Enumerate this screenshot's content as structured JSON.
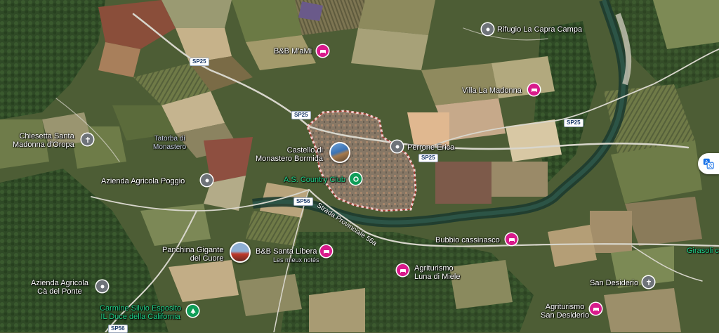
{
  "places": {
    "rifugio": "Rifugio La Capra Campa",
    "bb_mami": "B&B M'aMi",
    "villa_madonna": "Villa La Madonna",
    "chiesetta": "Chiesetta Santa\nMadonna d'Oropa",
    "tatorba": "Tatorba di\nMonastero",
    "castello": "Castello di\nMonastero Bormida",
    "perrone": "Perrone Erica",
    "country_club": "A.S. Country Club",
    "azienda_poggio": "Azienda Agricola Poggio",
    "panchina": "Panchina Gigante\ndel Cuore",
    "bb_santa_libera": "B&B Santa Libera",
    "bb_santa_libera_sub": "Les mieux notés",
    "bubbio": "Bubbio cassinasco",
    "girasoli": "Girasoli c",
    "agriturismo_luna": "Agriturismo\nLuna di Miele",
    "azienda_ponte": "Azienda Agricola\nCà del Ponte",
    "san_desiderio": "San Desiderio",
    "carmine": "Carmine Silvio Esposito\nIL Duce della California",
    "agriturismo_sd": "Agriturismo\nSan Desiderio"
  },
  "roads": {
    "sp25": "SP25",
    "sp56": "SP56",
    "strada": "Strada Provinciale 56a"
  },
  "icons": {
    "translate": "translate-icon"
  },
  "colors": {
    "boundary": "#f2d0cf",
    "pin_pink": "#d81b8c",
    "pin_gray": "#6e7379",
    "pin_green": "#0f9d58",
    "label_green": "#1fd48a"
  }
}
